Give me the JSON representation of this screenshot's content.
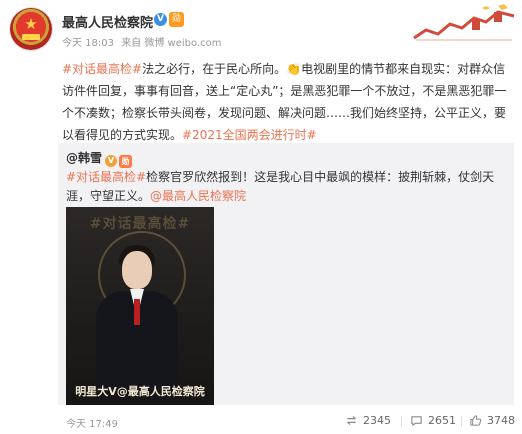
{
  "post": {
    "account_name": "最高人民检察院",
    "verified_badge": "V",
    "medal_badge": "勋",
    "meta": {
      "date": "今天 18:03",
      "source": "来自 微博 weibo.com"
    },
    "text": {
      "hashtag1": "#对话最高检#",
      "part1": "法之必行，在于民心所向。",
      "clap_icon": "clap-icon",
      "part2": "电视剧里的情节都来自现实：对群众信访件件回复，事事有回音，送上“定心丸”；是黑恶犯罪一个不放过，不是黑恶犯罪一个不凑数；检察长带头阅卷，发现问题、解决问题……我们始终坚持，公平正义，要以看得见的方式实现。",
      "hashtag2": "#2021全国两会进行时#"
    }
  },
  "repost": {
    "author": "@韩雪",
    "badges": [
      "V",
      "勋"
    ],
    "text": {
      "hashtag": "#对话最高检#",
      "body": "检察官罗欣然报到！这是我心目中最飒的模样：披荆斩棘，仗剑天涯，守望正义。",
      "mention": "@最高人民检察院"
    },
    "image": {
      "top_text": "#对话最高检#",
      "bottom_text": "明星大V@最高人民检察院"
    }
  },
  "footer": {
    "time": "今天 17:49",
    "repost_count": "2345",
    "comment_count": "2651",
    "like_count": "3748"
  },
  "colors": {
    "hashtag": "#eb7350",
    "repost_bg": "#f2f2f5",
    "verified_blue": "#3a8ee6"
  }
}
